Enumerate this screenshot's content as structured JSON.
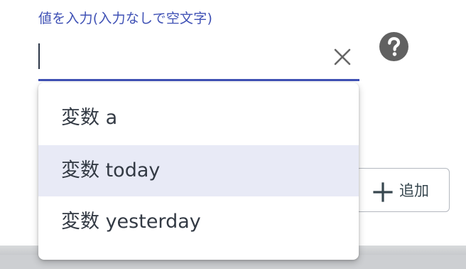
{
  "field": {
    "label": "値を入力(入力なしで空文字)",
    "value": "",
    "label_color": "#3f51b5",
    "underline_color": "#3f51b5"
  },
  "icons": {
    "clear": "close-icon",
    "help": "help-icon",
    "add": "plus-icon"
  },
  "dropdown": {
    "options": [
      {
        "label": "変数 a"
      },
      {
        "label": "変数 today"
      },
      {
        "label": "変数 yesterday"
      }
    ],
    "highlighted_index": 1,
    "highlight_color": "#e8eaf6"
  },
  "add_button": {
    "label": "追加"
  },
  "colors": {
    "icon_gray": "#616161",
    "text_dark": "#333a44"
  }
}
